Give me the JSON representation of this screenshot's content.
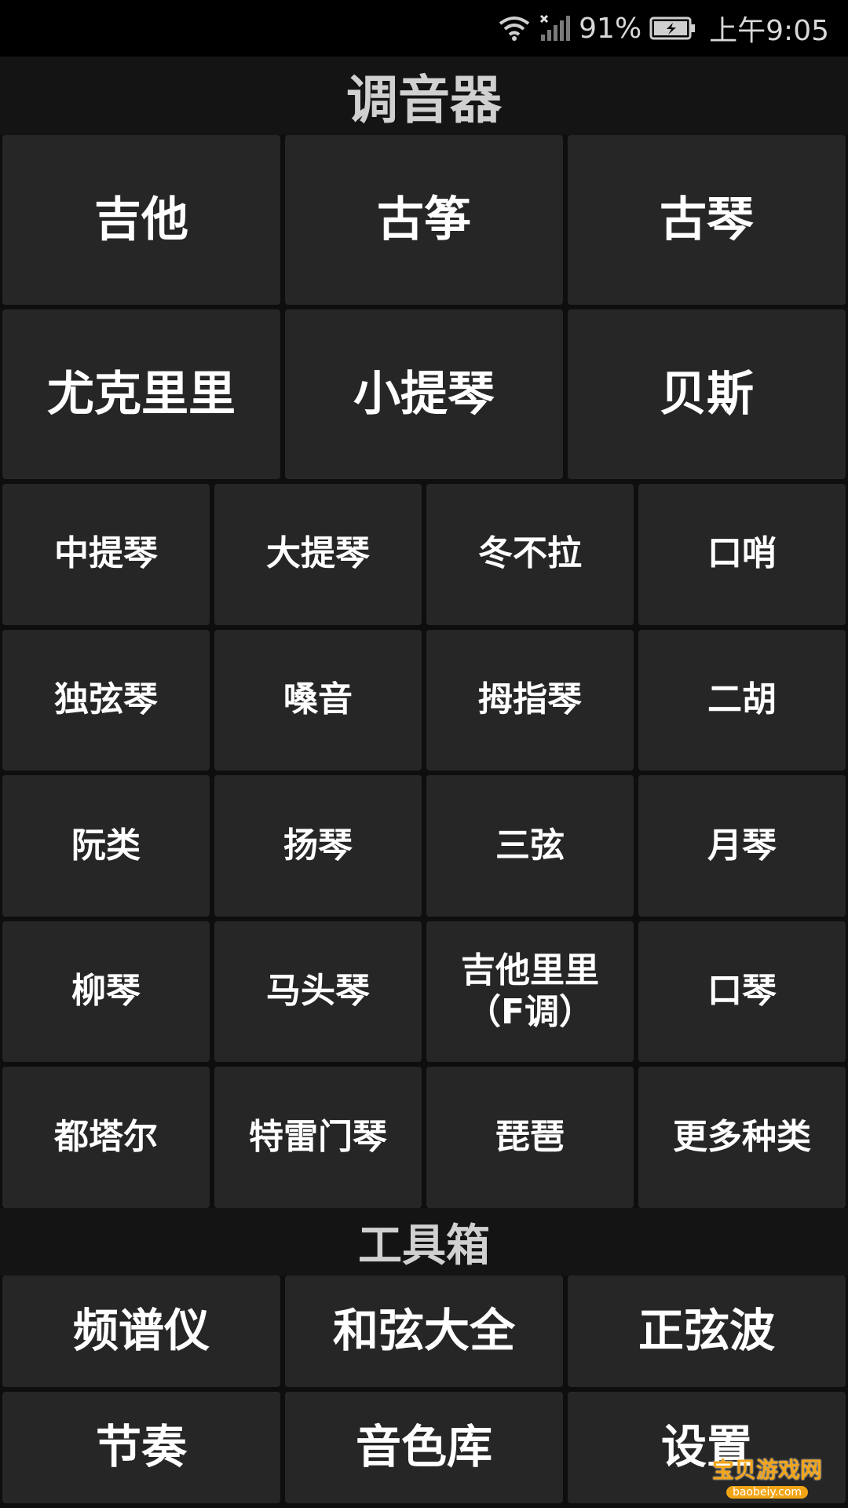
{
  "status_bar": {
    "battery_percent": "91%",
    "time": "上午9:05",
    "icons": [
      "wifi-icon",
      "signal-off-icon",
      "battery-charging-icon"
    ]
  },
  "header": {
    "title": "调音器"
  },
  "instruments_big": [
    {
      "label": "吉他"
    },
    {
      "label": "古筝"
    },
    {
      "label": "古琴"
    },
    {
      "label": "尤克里里"
    },
    {
      "label": "小提琴"
    },
    {
      "label": "贝斯"
    }
  ],
  "instruments_small": [
    {
      "label": "中提琴"
    },
    {
      "label": "大提琴"
    },
    {
      "label": "冬不拉"
    },
    {
      "label": "口哨"
    },
    {
      "label": "独弦琴"
    },
    {
      "label": "嗓音"
    },
    {
      "label": "拇指琴"
    },
    {
      "label": "二胡"
    },
    {
      "label": "阮类"
    },
    {
      "label": "扬琴"
    },
    {
      "label": "三弦"
    },
    {
      "label": "月琴"
    },
    {
      "label": "柳琴"
    },
    {
      "label": "马头琴"
    },
    {
      "label": "吉他里里\n（F调）"
    },
    {
      "label": "口琴"
    },
    {
      "label": "都塔尔"
    },
    {
      "label": "特雷门琴"
    },
    {
      "label": "琵琶"
    },
    {
      "label": "更多种类"
    }
  ],
  "toolbox": {
    "title": "工具箱",
    "items": [
      {
        "label": "频谱仪"
      },
      {
        "label": "和弦大全"
      },
      {
        "label": "正弦波"
      },
      {
        "label": "节奏"
      },
      {
        "label": "音色库"
      },
      {
        "label": "设置"
      }
    ]
  },
  "watermark": {
    "text": "宝贝游戏网",
    "url": "baobeiy.com"
  },
  "colors": {
    "background": "#000000",
    "tile": "#262626",
    "header": "#141414",
    "text": "#ffffff"
  }
}
